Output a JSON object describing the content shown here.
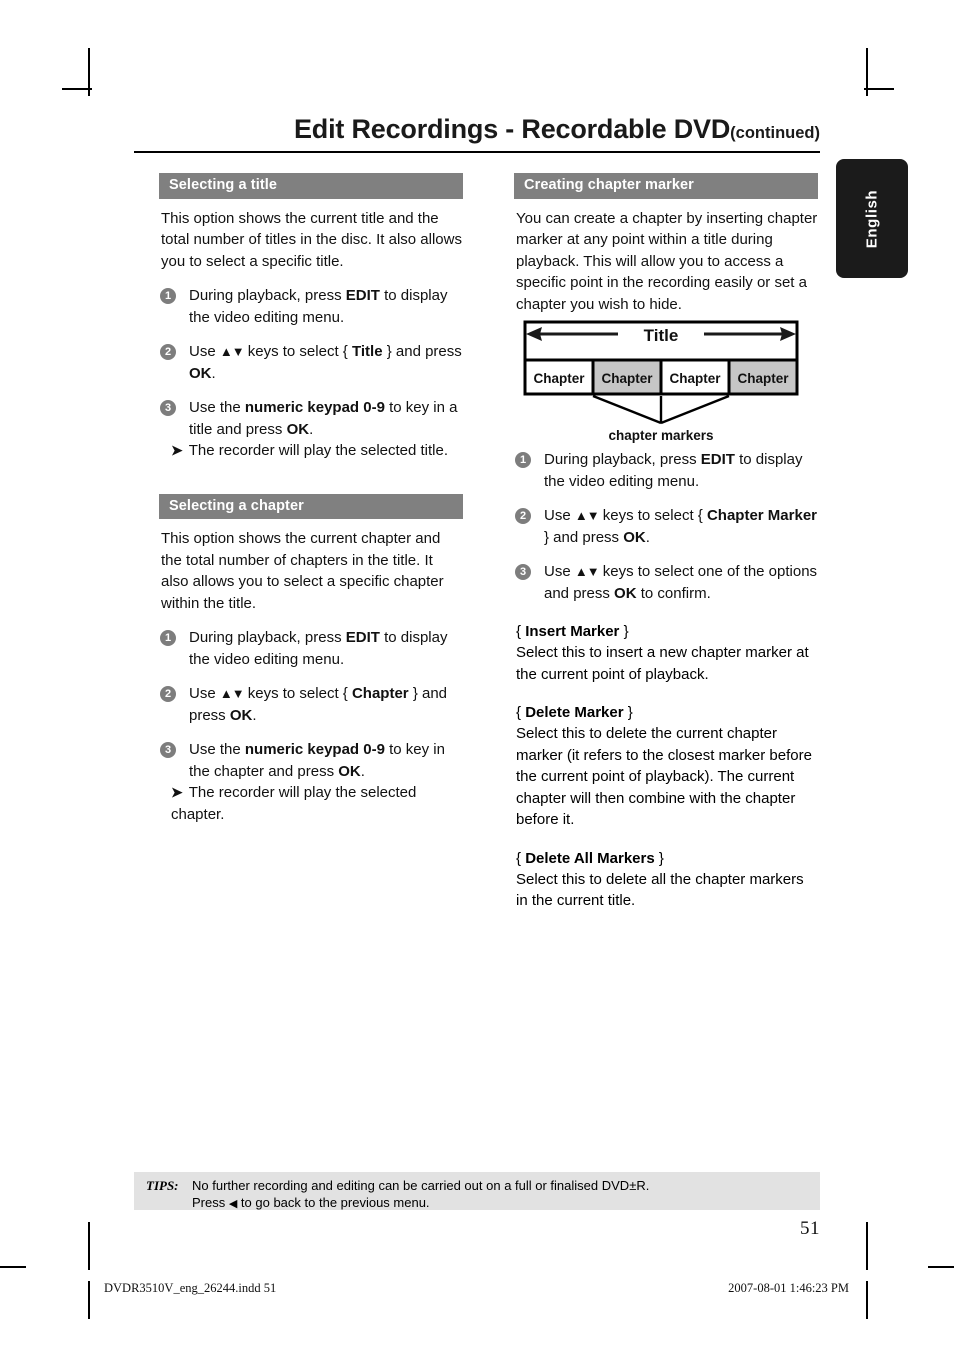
{
  "header": {
    "title": "Edit Recordings - Recordable DVD",
    "continued": "(continued)"
  },
  "language_tab": {
    "label": "English"
  },
  "left_column": {
    "sections": [
      {
        "heading": "Selecting a title",
        "intro": "This option shows the current title and the total number of titles in the disc. It also allows you to select a specific title.",
        "steps": [
          {
            "number": "1",
            "pre": "During playback, press ",
            "bold": "EDIT",
            "post": " to display the video editing menu."
          },
          {
            "number": "2",
            "pre": "Use ",
            "keys": "▲▼",
            "mid": " keys to select { ",
            "bold": "Title",
            "mid2": " } and press ",
            "bold2": "OK",
            "post": "."
          },
          {
            "number": "3",
            "pre": "Use the ",
            "bold": "numeric keypad 0-9",
            "mid": " to key in a title and press ",
            "bold2": "OK",
            "post": ".",
            "result": "The recorder will play the selected title."
          }
        ]
      },
      {
        "heading": "Selecting a chapter",
        "intro": "This option shows the current chapter and the total number of chapters in the title. It also allows you to select a specific chapter within the title.",
        "steps": [
          {
            "number": "1",
            "pre": "During playback, press ",
            "bold": "EDIT",
            "post": " to display the video editing menu."
          },
          {
            "number": "2",
            "pre": "Use ",
            "keys": "▲▼",
            "mid": " keys to select { ",
            "bold": "Chapter",
            "mid2": " } and press ",
            "bold2": "OK",
            "post": "."
          },
          {
            "number": "3",
            "pre": "Use the ",
            "bold": "numeric keypad 0-9",
            "mid": " to key in the chapter and press ",
            "bold2": "OK",
            "post": ".",
            "result": "The recorder will play the selected chapter."
          }
        ]
      }
    ]
  },
  "right_column": {
    "heading": "Creating chapter marker",
    "intro": "You can create a chapter by inserting chapter marker at any point within a title during playback. This will allow you to access a specific point in the recording easily or set a chapter you wish to hide.",
    "diagram": {
      "title_label": "Title",
      "chapters": [
        "Chapter",
        "Chapter",
        "Chapter",
        "Chapter"
      ],
      "chapter_fills": [
        "#ffffff",
        "#c6c6c6",
        "#ffffff",
        "#c6c6c6"
      ],
      "caption": "chapter markers"
    },
    "steps": [
      {
        "number": "1",
        "pre": "During playback, press ",
        "bold": "EDIT",
        "post": " to display the video editing menu."
      },
      {
        "number": "2",
        "pre": "Use ",
        "keys": "▲▼",
        "mid": " keys to select  { ",
        "bold": "Chapter Marker",
        "mid2": " } and press ",
        "bold2": "OK",
        "post": "."
      },
      {
        "number": "3",
        "pre": "Use ",
        "keys": "▲▼",
        "mid": " keys to select one of the options and press ",
        "bold2": "OK",
        "post": " to confirm."
      }
    ],
    "options": [
      {
        "title_open": "{ ",
        "title_bold": "Insert Marker",
        "title_close": " }",
        "body": "Select this to insert a new chapter marker at the current point of playback."
      },
      {
        "title_open": "{ ",
        "title_bold": "Delete Marker",
        "title_close": " }",
        "body": "Select this to delete the current chapter marker (it refers to the closest marker before the current point of playback). The current chapter will then combine with the chapter before it."
      },
      {
        "title_open": "{ ",
        "title_bold": "Delete All Markers",
        "title_close": " }",
        "body": "Select this to delete all the chapter markers in the current title."
      }
    ]
  },
  "tips": {
    "label": "TIPS:",
    "line1": "No further recording and editing can be carried out on a full or finalised DVD±R.",
    "line2_pre": "Press ",
    "line2_key": "◀",
    "line2_post": " to go back to the previous menu."
  },
  "page_number": "51",
  "footer": {
    "file": "DVDR3510V_eng_26244.indd   51",
    "timestamp": "2007-08-01   1:46:23 PM"
  },
  "colors": {
    "section_heading_bg": "#808080",
    "step_bullet_bg": "#7d7d7d",
    "tips_bg": "#e2e2e2",
    "language_tab_bg": "#1b1b1b",
    "diagram_shaded_chapter": "#c6c6c6"
  }
}
